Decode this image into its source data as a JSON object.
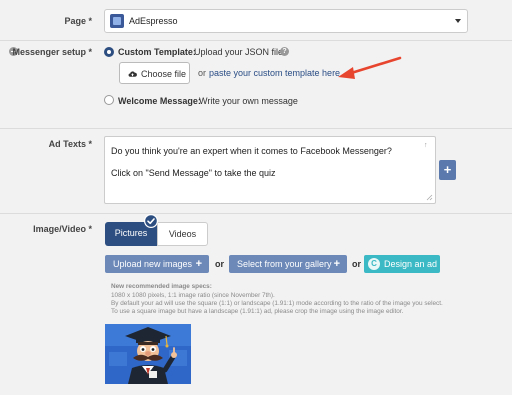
{
  "page": {
    "label": "Page *",
    "selected": "AdEspresso"
  },
  "messenger": {
    "label": "Messenger setup *",
    "custom": {
      "title": "Custom Template:",
      "desc": "Upload your JSON file",
      "help": "?",
      "choose_file": "Choose file",
      "or": "or",
      "paste_link": "paste your custom template here"
    },
    "welcome": {
      "title": "Welcome Message:",
      "desc": "Write your own message"
    }
  },
  "ad_texts": {
    "label": "Ad Texts *",
    "line1": "Do you think you're an expert when it comes to Facebook Messenger?",
    "line2": "Click on \"Send Message\" to take the quiz",
    "counter": "↑",
    "add": "+"
  },
  "image_video": {
    "label": "Image/Video *",
    "tab_pictures": "Pictures",
    "tab_videos": "Videos",
    "upload": "Upload new images",
    "or1": "or",
    "gallery": "Select from your gallery",
    "or2": "or",
    "design": "Design an ad",
    "design_icon": "C",
    "plus": "+",
    "specs": {
      "title": "New recommended image specs:",
      "line1": "1080 x 1080 pixels, 1:1 image ratio (since November 7th).",
      "line2": "By default your ad will use the square (1:1) or landscape (1.91:1) mode according to the ratio of the image you select.",
      "line3": "To use a square image but have a landscape (1.91:1) ad, please crop the image using the image editor."
    }
  },
  "colors": {
    "accent": "#2d4e80",
    "button_blue": "#6c89b8",
    "teal": "#3bb9c4",
    "arrow": "#e8452f"
  }
}
